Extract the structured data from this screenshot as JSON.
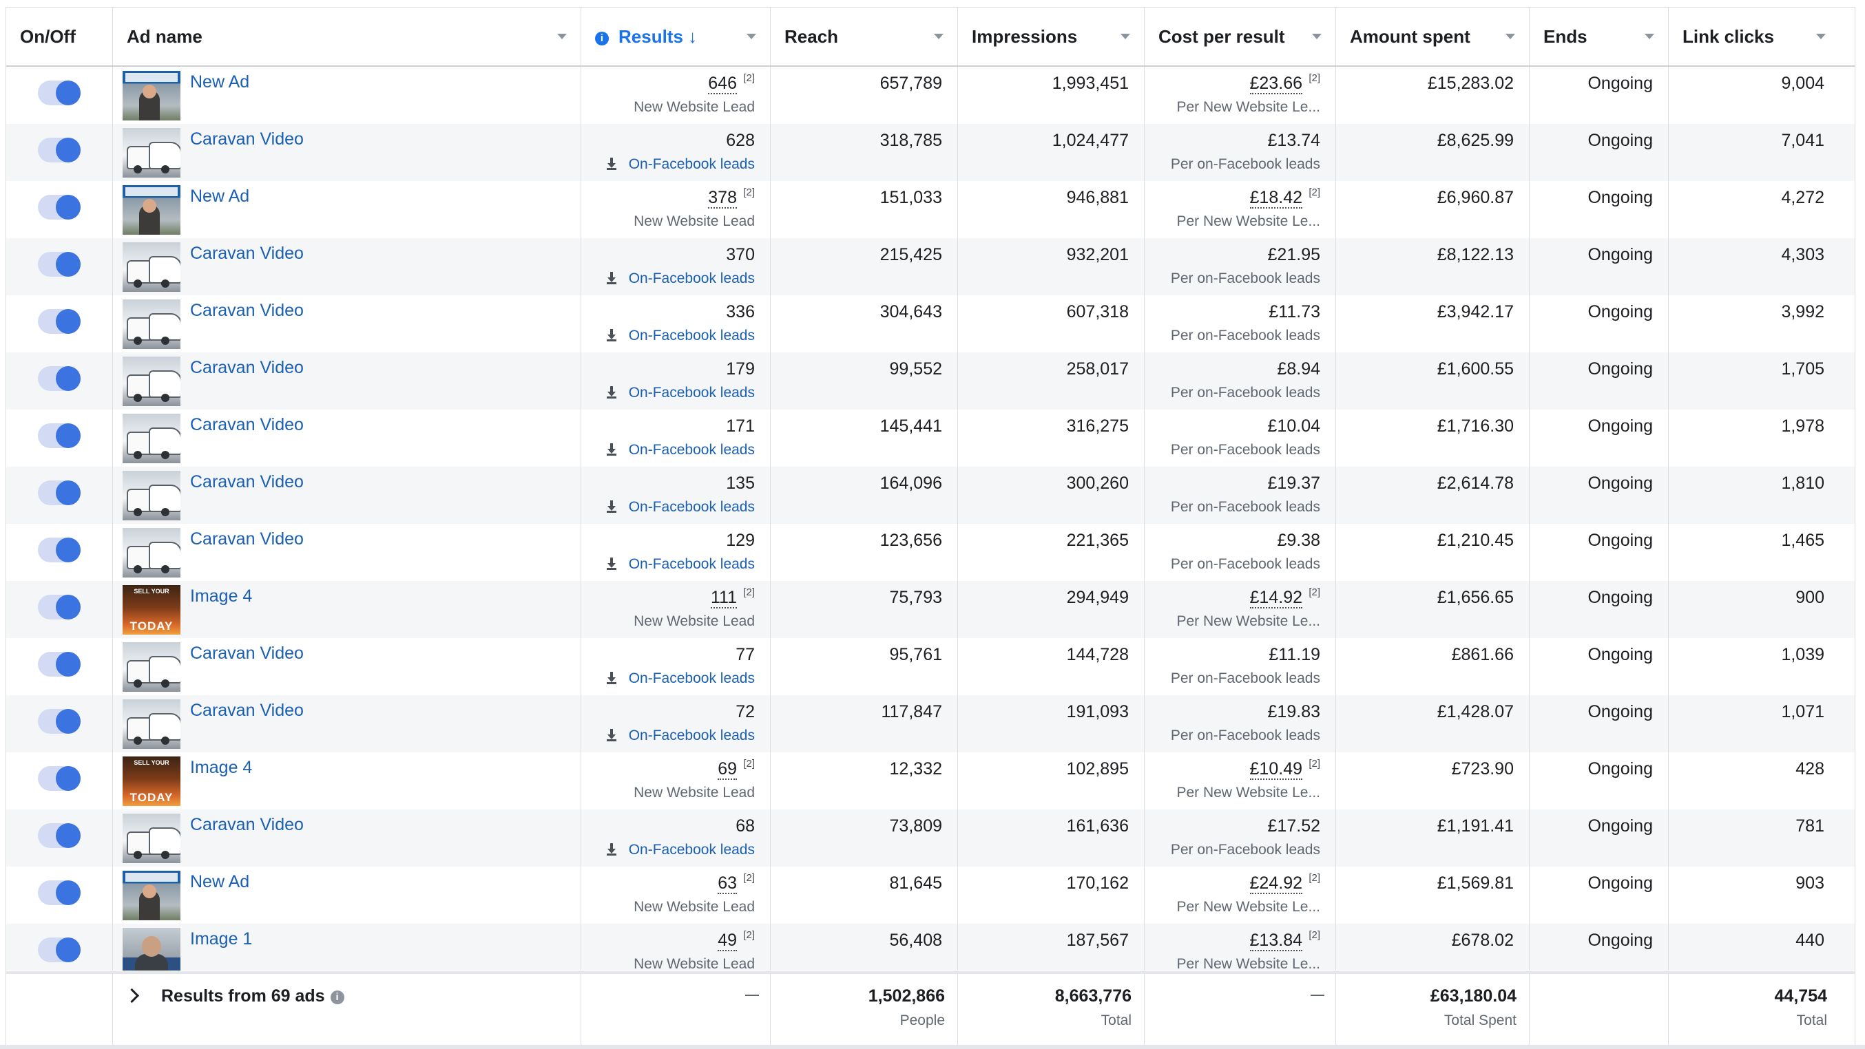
{
  "columns": {
    "onoff": "On/Off",
    "adname": "Ad name",
    "results": "Results",
    "results_sort": "↓",
    "reach": "Reach",
    "impressions": "Impressions",
    "cpr": "Cost per result",
    "amount": "Amount spent",
    "ends": "Ends",
    "clicks": "Link clicks"
  },
  "sup_mark": "[2]",
  "rows": [
    {
      "name": "New Ad",
      "thumb": "newad",
      "results": "646",
      "results_sub": "New Website Lead",
      "sup": true,
      "reach": "657,789",
      "impressions": "1,993,451",
      "cpr": "£23.66",
      "cpr_sub": "Per New Website Le...",
      "amount": "£15,283.02",
      "ends": "Ongoing",
      "clicks": "9,004"
    },
    {
      "name": "Caravan Video",
      "thumb": "caravan",
      "results": "628",
      "results_sub": "On-Facebook leads",
      "sup": false,
      "reach": "318,785",
      "impressions": "1,024,477",
      "cpr": "£13.74",
      "cpr_sub": "Per on-Facebook leads",
      "amount": "£8,625.99",
      "ends": "Ongoing",
      "clicks": "7,041"
    },
    {
      "name": "New Ad",
      "thumb": "newad",
      "results": "378",
      "results_sub": "New Website Lead",
      "sup": true,
      "reach": "151,033",
      "impressions": "946,881",
      "cpr": "£18.42",
      "cpr_sub": "Per New Website Le...",
      "amount": "£6,960.87",
      "ends": "Ongoing",
      "clicks": "4,272"
    },
    {
      "name": "Caravan Video",
      "thumb": "caravan",
      "results": "370",
      "results_sub": "On-Facebook leads",
      "sup": false,
      "reach": "215,425",
      "impressions": "932,201",
      "cpr": "£21.95",
      "cpr_sub": "Per on-Facebook leads",
      "amount": "£8,122.13",
      "ends": "Ongoing",
      "clicks": "4,303"
    },
    {
      "name": "Caravan Video",
      "thumb": "caravan",
      "results": "336",
      "results_sub": "On-Facebook leads",
      "sup": false,
      "reach": "304,643",
      "impressions": "607,318",
      "cpr": "£11.73",
      "cpr_sub": "Per on-Facebook leads",
      "amount": "£3,942.17",
      "ends": "Ongoing",
      "clicks": "3,992"
    },
    {
      "name": "Caravan Video",
      "thumb": "caravan",
      "results": "179",
      "results_sub": "On-Facebook leads",
      "sup": false,
      "reach": "99,552",
      "impressions": "258,017",
      "cpr": "£8.94",
      "cpr_sub": "Per on-Facebook leads",
      "amount": "£1,600.55",
      "ends": "Ongoing",
      "clicks": "1,705"
    },
    {
      "name": "Caravan Video",
      "thumb": "caravan",
      "results": "171",
      "results_sub": "On-Facebook leads",
      "sup": false,
      "reach": "145,441",
      "impressions": "316,275",
      "cpr": "£10.04",
      "cpr_sub": "Per on-Facebook leads",
      "amount": "£1,716.30",
      "ends": "Ongoing",
      "clicks": "1,978"
    },
    {
      "name": "Caravan Video",
      "thumb": "caravan",
      "results": "135",
      "results_sub": "On-Facebook leads",
      "sup": false,
      "reach": "164,096",
      "impressions": "300,260",
      "cpr": "£19.37",
      "cpr_sub": "Per on-Facebook leads",
      "amount": "£2,614.78",
      "ends": "Ongoing",
      "clicks": "1,810"
    },
    {
      "name": "Caravan Video",
      "thumb": "caravan",
      "results": "129",
      "results_sub": "On-Facebook leads",
      "sup": false,
      "reach": "123,656",
      "impressions": "221,365",
      "cpr": "£9.38",
      "cpr_sub": "Per on-Facebook leads",
      "amount": "£1,210.45",
      "ends": "Ongoing",
      "clicks": "1,465"
    },
    {
      "name": "Image 4",
      "thumb": "image4",
      "results": "111",
      "results_sub": "New Website Lead",
      "sup": true,
      "reach": "75,793",
      "impressions": "294,949",
      "cpr": "£14.92",
      "cpr_sub": "Per New Website Le...",
      "amount": "£1,656.65",
      "ends": "Ongoing",
      "clicks": "900"
    },
    {
      "name": "Caravan Video",
      "thumb": "caravan",
      "results": "77",
      "results_sub": "On-Facebook leads",
      "sup": false,
      "reach": "95,761",
      "impressions": "144,728",
      "cpr": "£11.19",
      "cpr_sub": "Per on-Facebook leads",
      "amount": "£861.66",
      "ends": "Ongoing",
      "clicks": "1,039"
    },
    {
      "name": "Caravan Video",
      "thumb": "caravan",
      "results": "72",
      "results_sub": "On-Facebook leads",
      "sup": false,
      "reach": "117,847",
      "impressions": "191,093",
      "cpr": "£19.83",
      "cpr_sub": "Per on-Facebook leads",
      "amount": "£1,428.07",
      "ends": "Ongoing",
      "clicks": "1,071"
    },
    {
      "name": "Image 4",
      "thumb": "image4",
      "results": "69",
      "results_sub": "New Website Lead",
      "sup": true,
      "reach": "12,332",
      "impressions": "102,895",
      "cpr": "£10.49",
      "cpr_sub": "Per New Website Le...",
      "amount": "£723.90",
      "ends": "Ongoing",
      "clicks": "428"
    },
    {
      "name": "Caravan Video",
      "thumb": "caravan",
      "results": "68",
      "results_sub": "On-Facebook leads",
      "sup": false,
      "reach": "73,809",
      "impressions": "161,636",
      "cpr": "£17.52",
      "cpr_sub": "Per on-Facebook leads",
      "amount": "£1,191.41",
      "ends": "Ongoing",
      "clicks": "781"
    },
    {
      "name": "New Ad",
      "thumb": "newad",
      "results": "63",
      "results_sub": "New Website Lead",
      "sup": true,
      "reach": "81,645",
      "impressions": "170,162",
      "cpr": "£24.92",
      "cpr_sub": "Per New Website Le...",
      "amount": "£1,569.81",
      "ends": "Ongoing",
      "clicks": "903"
    },
    {
      "name": "Image 1",
      "thumb": "image1",
      "results": "49",
      "results_sub": "New Website Lead",
      "sup": true,
      "reach": "56,408",
      "impressions": "187,567",
      "cpr": "£13.84",
      "cpr_sub": "Per New Website Le...",
      "amount": "£678.02",
      "ends": "Ongoing",
      "clicks": "440"
    }
  ],
  "thumb_text": {
    "image4_top": "SELL YOUR",
    "image4_bottom": "TODAY"
  },
  "footer": {
    "title": "Results from 69 ads",
    "reach": "1,502,866",
    "reach_sub": "People",
    "impressions": "8,663,776",
    "impressions_sub": "Total",
    "amount": "£63,180.04",
    "amount_sub": "Total Spent",
    "clicks": "44,754",
    "clicks_sub": "Total"
  },
  "colors": {
    "link": "#1a5fb4",
    "toggle_on": "#3b73e0",
    "toggle_track": "#d2dbf3"
  }
}
